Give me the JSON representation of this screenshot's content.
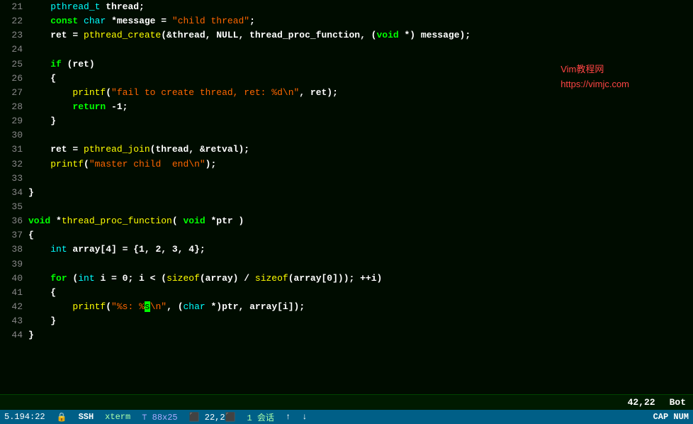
{
  "editor": {
    "lines": [
      {
        "num": "21",
        "content": [
          {
            "t": "    ",
            "c": "normal"
          },
          {
            "t": "pthread_t",
            "c": "type"
          },
          {
            "t": " thread;",
            "c": "white"
          }
        ]
      },
      {
        "num": "22",
        "content": [
          {
            "t": "    ",
            "c": "normal"
          },
          {
            "t": "const",
            "c": "kw"
          },
          {
            "t": " ",
            "c": "normal"
          },
          {
            "t": "char",
            "c": "type"
          },
          {
            "t": " *message = ",
            "c": "white"
          },
          {
            "t": "\"child thread\"",
            "c": "str"
          },
          {
            "t": ";",
            "c": "white"
          }
        ]
      },
      {
        "num": "23",
        "content": [
          {
            "t": "    ret = ",
            "c": "white"
          },
          {
            "t": "pthread_create",
            "c": "fn"
          },
          {
            "t": "(&thread, NULL, thread_proc_function, (",
            "c": "white"
          },
          {
            "t": "void",
            "c": "kw"
          },
          {
            "t": " *) message);",
            "c": "white"
          }
        ]
      },
      {
        "num": "24",
        "content": []
      },
      {
        "num": "25",
        "content": [
          {
            "t": "    ",
            "c": "normal"
          },
          {
            "t": "if",
            "c": "kw"
          },
          {
            "t": " (ret)",
            "c": "white"
          }
        ]
      },
      {
        "num": "26",
        "content": [
          {
            "t": "    {",
            "c": "white"
          }
        ]
      },
      {
        "num": "27",
        "content": [
          {
            "t": "        ",
            "c": "normal"
          },
          {
            "t": "printf",
            "c": "fn"
          },
          {
            "t": "(",
            "c": "white"
          },
          {
            "t": "\"fail to create thread, ret: %d\\n\"",
            "c": "str"
          },
          {
            "t": ", ret);",
            "c": "white"
          }
        ]
      },
      {
        "num": "28",
        "content": [
          {
            "t": "        ",
            "c": "normal"
          },
          {
            "t": "return",
            "c": "kw"
          },
          {
            "t": " -1;",
            "c": "white"
          }
        ]
      },
      {
        "num": "29",
        "content": [
          {
            "t": "    }",
            "c": "white"
          }
        ]
      },
      {
        "num": "30",
        "content": []
      },
      {
        "num": "31",
        "content": [
          {
            "t": "    ret = ",
            "c": "white"
          },
          {
            "t": "pthread_join",
            "c": "fn"
          },
          {
            "t": "(thread, &retval);",
            "c": "white"
          }
        ]
      },
      {
        "num": "32",
        "content": [
          {
            "t": "    ",
            "c": "normal"
          },
          {
            "t": "printf",
            "c": "fn"
          },
          {
            "t": "(",
            "c": "white"
          },
          {
            "t": "\"master child  end\\n\"",
            "c": "str"
          },
          {
            "t": ");",
            "c": "white"
          }
        ]
      },
      {
        "num": "33",
        "content": []
      },
      {
        "num": "34",
        "content": [
          {
            "t": "}",
            "c": "white"
          }
        ]
      },
      {
        "num": "35",
        "content": []
      },
      {
        "num": "36",
        "content": [
          {
            "t": "void",
            "c": "kw"
          },
          {
            "t": " *",
            "c": "white"
          },
          {
            "t": "thread_proc_function",
            "c": "fn"
          },
          {
            "t": "( ",
            "c": "white"
          },
          {
            "t": "void",
            "c": "kw"
          },
          {
            "t": " *ptr )",
            "c": "white"
          }
        ]
      },
      {
        "num": "37",
        "content": [
          {
            "t": "{",
            "c": "white"
          }
        ]
      },
      {
        "num": "38",
        "content": [
          {
            "t": "    ",
            "c": "normal"
          },
          {
            "t": "int",
            "c": "type"
          },
          {
            "t": " array[4] = {1, 2, 3, 4};",
            "c": "white"
          }
        ]
      },
      {
        "num": "39",
        "content": []
      },
      {
        "num": "40",
        "content": [
          {
            "t": "    ",
            "c": "normal"
          },
          {
            "t": "for",
            "c": "kw"
          },
          {
            "t": " (",
            "c": "white"
          },
          {
            "t": "int",
            "c": "type"
          },
          {
            "t": " i = 0; i < (",
            "c": "white"
          },
          {
            "t": "sizeof",
            "c": "fn"
          },
          {
            "t": "(array) / ",
            "c": "white"
          },
          {
            "t": "sizeof",
            "c": "fn"
          },
          {
            "t": "(array[0])); ++i)",
            "c": "white"
          }
        ]
      },
      {
        "num": "41",
        "content": [
          {
            "t": "    {",
            "c": "white"
          }
        ]
      },
      {
        "num": "42",
        "content": [
          {
            "t": "        ",
            "c": "normal"
          },
          {
            "t": "printf",
            "c": "fn"
          },
          {
            "t": "(",
            "c": "white"
          },
          {
            "t": "\"",
            "c": "str"
          },
          {
            "t": "%s: %",
            "c": "str"
          },
          {
            "t": "s",
            "c": "cursor-char"
          },
          {
            "t": "\\n\"",
            "c": "str"
          },
          {
            "t": ", (",
            "c": "white"
          },
          {
            "t": "char",
            "c": "type"
          },
          {
            "t": " *)ptr, array[i]);",
            "c": "white"
          }
        ]
      },
      {
        "num": "43",
        "content": [
          {
            "t": "    }",
            "c": "white"
          }
        ]
      },
      {
        "num": "44",
        "content": [
          {
            "t": "}",
            "c": "white"
          }
        ]
      }
    ],
    "watermark_line1": "Vim教程网",
    "watermark_line2": "https://vimjc.com",
    "pos": "42,22",
    "scroll": "Bot"
  },
  "statusbar": {
    "ip_time": "5.194:22",
    "ssh_icon": "🔒",
    "ssh": "SSH",
    "xterm": "xterm",
    "size": "⊤ 88x25",
    "info": "⬛ 22,2⬛",
    "session": "1 会话",
    "arrow_up": "↑",
    "arrow_down": "↓",
    "cap": "CAP NUM"
  }
}
